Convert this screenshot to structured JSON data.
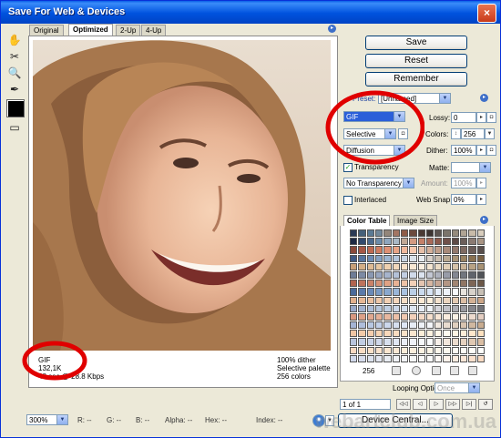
{
  "window": {
    "title": "Save For Web & Devices",
    "close": "×"
  },
  "tabs": [
    "Original",
    "Optimized",
    "2-Up",
    "4-Up"
  ],
  "preview": {
    "left_info": [
      "GIF",
      "132,1K",
      "48 sec @ 28.8 Kbps"
    ],
    "right_info": [
      "100% dither",
      "Selective palette",
      "256 colors"
    ]
  },
  "buttons": {
    "save": "Save",
    "reset": "Reset",
    "remember": "Remember"
  },
  "settings": {
    "preset_label": "Preset:",
    "preset_value": "[Unnamed]",
    "format": "GIF",
    "reduction": "Selective",
    "dither_algorithm": "Diffusion",
    "transparency_label": "Transparency",
    "transparency_checked": true,
    "transparency_dither": "No Transparency ...",
    "interlaced_label": "Interlaced",
    "interlaced_checked": false,
    "lossy_label": "Lossy:",
    "lossy_value": "0",
    "colors_label": "Colors:",
    "colors_value": "256",
    "dither_label": "Dither:",
    "dither_value": "100%",
    "matte_label": "Matte:",
    "matte_value": "",
    "amount_label": "Amount:",
    "amount_value": "100%",
    "websnap_label": "Web Snap:",
    "websnap_value": "0%"
  },
  "color_panel": {
    "tabs": [
      "Color Table",
      "Image Size"
    ],
    "count": "256",
    "swatches": [
      "#2b3a55",
      "#45607a",
      "#5a7a94",
      "#71889a",
      "#93867a",
      "#a37563",
      "#8f5c48",
      "#6c4a3e",
      "#4a3a34",
      "#3c3431",
      "#5b534f",
      "#7b746b",
      "#958b7d",
      "#b0a494",
      "#c8baa8",
      "#d8cdbd",
      "#1e2a44",
      "#324a6e",
      "#4b6a8e",
      "#6c8caa",
      "#8ea6be",
      "#a9b8c6",
      "#c0a896",
      "#d29a82",
      "#c48068",
      "#a96a58",
      "#8c5a4c",
      "#70504a",
      "#5d4a46",
      "#6b5e5a",
      "#8a7a72",
      "#a89484",
      "#8a4a3a",
      "#a65846",
      "#bd6a52",
      "#cf7c60",
      "#de9074",
      "#e8a486",
      "#f0b89c",
      "#f5c8ae",
      "#e6bfa8",
      "#d4b09a",
      "#c09e8a",
      "#a88a7a",
      "#92786c",
      "#7e6a62",
      "#6a5c58",
      "#584e4c",
      "#3e5a84",
      "#56749e",
      "#6c8ab2",
      "#84a0c2",
      "#9cb4d0",
      "#b4c6dc",
      "#c8d4e2",
      "#dae2ea",
      "#e8ecf0",
      "#d8d0c8",
      "#c8bcae",
      "#b8a892",
      "#a89478",
      "#988262",
      "#887050",
      "#786044",
      "#c8a078",
      "#d4ae86",
      "#deba94",
      "#e6c6a2",
      "#eed0b0",
      "#f2d8bc",
      "#f6e0c8",
      "#f8e8d4",
      "#fbefe0",
      "#f5e6d2",
      "#ecdcc6",
      "#e2d0b8",
      "#d6c2a8",
      "#c8b296",
      "#b8a284",
      "#a89274",
      "#6e7c96",
      "#7c8aa4",
      "#8a98b2",
      "#98a6c0",
      "#a6b4cc",
      "#b4c2d8",
      "#c2cee2",
      "#d0daea",
      "#dce4f0",
      "#c4c8d4",
      "#aeb2be",
      "#989ca8",
      "#848892",
      "#72767e",
      "#60646c",
      "#505358",
      "#b06450",
      "#be735c",
      "#ca8268",
      "#d69276",
      "#e0a284",
      "#e8b294",
      "#eec2a6",
      "#f2d0b8",
      "#e4c4b0",
      "#d6b6a2",
      "#c6a694",
      "#b49684",
      "#a28674",
      "#907664",
      "#7e6656",
      "#6c5848",
      "#4a6a9a",
      "#5a7aaa",
      "#6a8ab8",
      "#7a9ac4",
      "#8aa8ce",
      "#9ab6d8",
      "#aac2e0",
      "#bacee6",
      "#cadaee",
      "#d8e4f4",
      "#e4ecf8",
      "#eef2fa",
      "#f6f8fc",
      "#e8e4de",
      "#d8d2ca",
      "#c8c0b6",
      "#e2b08c",
      "#e6b896",
      "#eac0a0",
      "#eec8aa",
      "#f2d0b4",
      "#f4d6bc",
      "#f6dcc4",
      "#f8e2cc",
      "#fae8d4",
      "#fceedc",
      "#f4e2ce",
      "#ecd6c0",
      "#e4cab2",
      "#dcbea4",
      "#d4b296",
      "#cca688",
      "#98a8c8",
      "#a2b2d0",
      "#acbcd6",
      "#b6c6dc",
      "#c0cee2",
      "#cad6e8",
      "#d4deec",
      "#dee6f2",
      "#e6ecf6",
      "#eef2f8",
      "#d6d6dc",
      "#c2c2c8",
      "#aeaeb4",
      "#9a9aa0",
      "#86868c",
      "#727278",
      "#d89880",
      "#dca088",
      "#e0a890",
      "#e4b098",
      "#e8b8a0",
      "#ecc0a8",
      "#f0c8b0",
      "#f2d0ba",
      "#f4d8c4",
      "#f6e0ce",
      "#f8e6d6",
      "#faecde",
      "#fcf2e6",
      "#f4e6da",
      "#ecdace",
      "#e4cec2",
      "#a4b4d4",
      "#aebedc",
      "#b8c8e2",
      "#c2d0e8",
      "#ccd8ec",
      "#d6e0f0",
      "#dee6f4",
      "#e6ecf6",
      "#eef2f8",
      "#f4f6fa",
      "#f0e8e0",
      "#e8dcd0",
      "#e0d0c0",
      "#d8c4b0",
      "#d0b8a0",
      "#c8ac90",
      "#f0c6a4",
      "#f2caa8",
      "#f4ceae",
      "#f6d4b4",
      "#f8d8ba",
      "#f8dcc0",
      "#fae2c8",
      "#fae6ce",
      "#fceed8",
      "#fdf2e0",
      "#fef6e8",
      "#fefaf0",
      "#fff4e4",
      "#ffeed8",
      "#ffe8cc",
      "#ffe2c0",
      "#b8c4dc",
      "#c0cce2",
      "#c8d2e6",
      "#d0d8ea",
      "#d8e0ee",
      "#e0e6f2",
      "#e8ecf4",
      "#f0f2f8",
      "#f6f8fa",
      "#fbfcfd",
      "#f8f0ea",
      "#f2e6dc",
      "#ecdcce",
      "#e6d2c0",
      "#e0c8b2",
      "#dabea4",
      "#f8d8c0",
      "#f8dcc4",
      "#f9e0c8",
      "#f9e2cc",
      "#fae6d0",
      "#fae8d4",
      "#fbecd8",
      "#fbeedc",
      "#fcf2e2",
      "#fcf4e6",
      "#fdf6ea",
      "#fdf8ee",
      "#fefaf2",
      "#fefcf6",
      "#fffdf8",
      "#fffefc",
      "#d0d8ea",
      "#d6dcec",
      "#dce2ee",
      "#e2e6f0",
      "#e8ecf2",
      "#eef0f4",
      "#f2f4f6",
      "#f6f8f8",
      "#fafafa",
      "#fcfcfc",
      "#fef8f4",
      "#fdf2ea",
      "#fcece0",
      "#fbe6d6",
      "#fae0cc",
      "#f9dac2"
    ]
  },
  "looping": {
    "label": "Looping Options:",
    "value": "Once"
  },
  "animation": {
    "frame": "1 of 1"
  },
  "bottom": {
    "zoom": "300%",
    "r": "R: --",
    "g": "G: --",
    "b": "B: --",
    "alpha": "Alpha: --",
    "hex": "Hex: --",
    "index": "Index: --",
    "device_central": "Device Central..."
  },
  "watermark": "webartclub.com.ua",
  "colors": {
    "title_bar": "#0052de",
    "annotation": "#e00000"
  }
}
